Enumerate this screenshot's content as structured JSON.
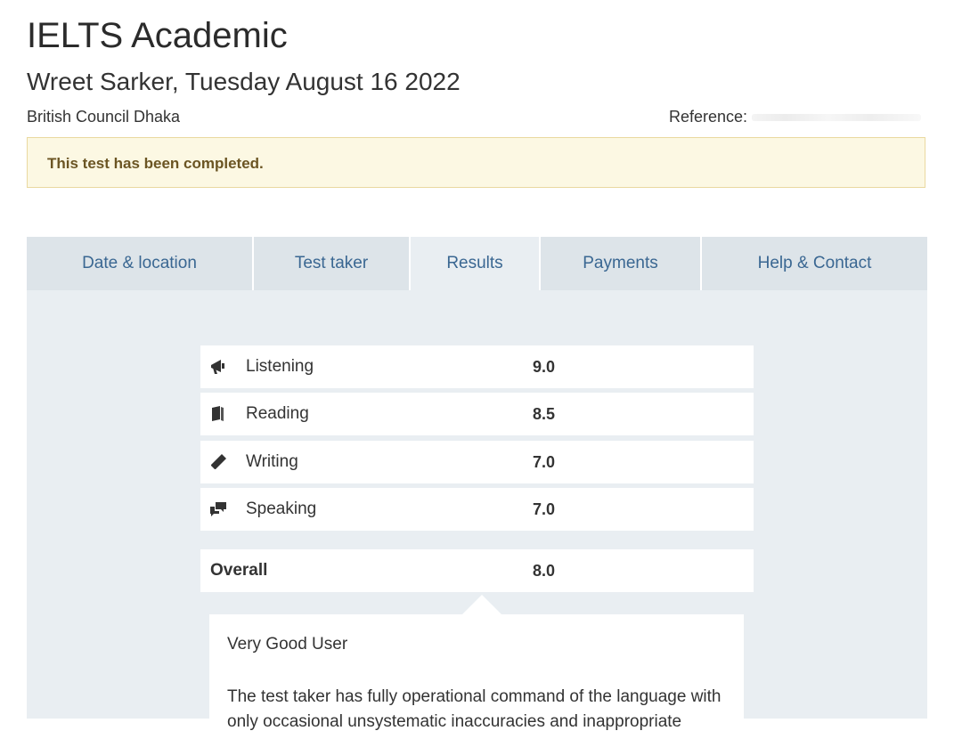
{
  "header": {
    "title": "IELTS Academic",
    "subtitle": "Wreet Sarker, Tuesday August 16 2022",
    "centre": "British Council Dhaka",
    "reference_label": "Reference:"
  },
  "alert": {
    "message": "This test has been completed."
  },
  "tabs": [
    {
      "label": "Date & location",
      "active": false
    },
    {
      "label": "Test taker",
      "active": false
    },
    {
      "label": "Results",
      "active": true
    },
    {
      "label": "Payments",
      "active": false
    },
    {
      "label": "Help & Contact",
      "active": false
    }
  ],
  "results": {
    "skills": [
      {
        "icon": "megaphone-icon",
        "label": "Listening",
        "score": "9.0"
      },
      {
        "icon": "book-icon",
        "label": "Reading",
        "score": "8.5"
      },
      {
        "icon": "pencil-icon",
        "label": "Writing",
        "score": "7.0"
      },
      {
        "icon": "speech-bubbles-icon",
        "label": "Speaking",
        "score": "7.0"
      }
    ],
    "overall": {
      "label": "Overall",
      "score": "8.0"
    },
    "band_title": "Very Good User",
    "band_description": "The test taker has fully operational command of the language with only occasional unsystematic inaccuracies and inappropriate"
  },
  "colors": {
    "tab_text": "#3a6792",
    "tab_bg": "#dde4e9",
    "panel_bg": "#e9eef2",
    "alert_bg": "#fcf8e3",
    "alert_text": "#6b5523"
  }
}
